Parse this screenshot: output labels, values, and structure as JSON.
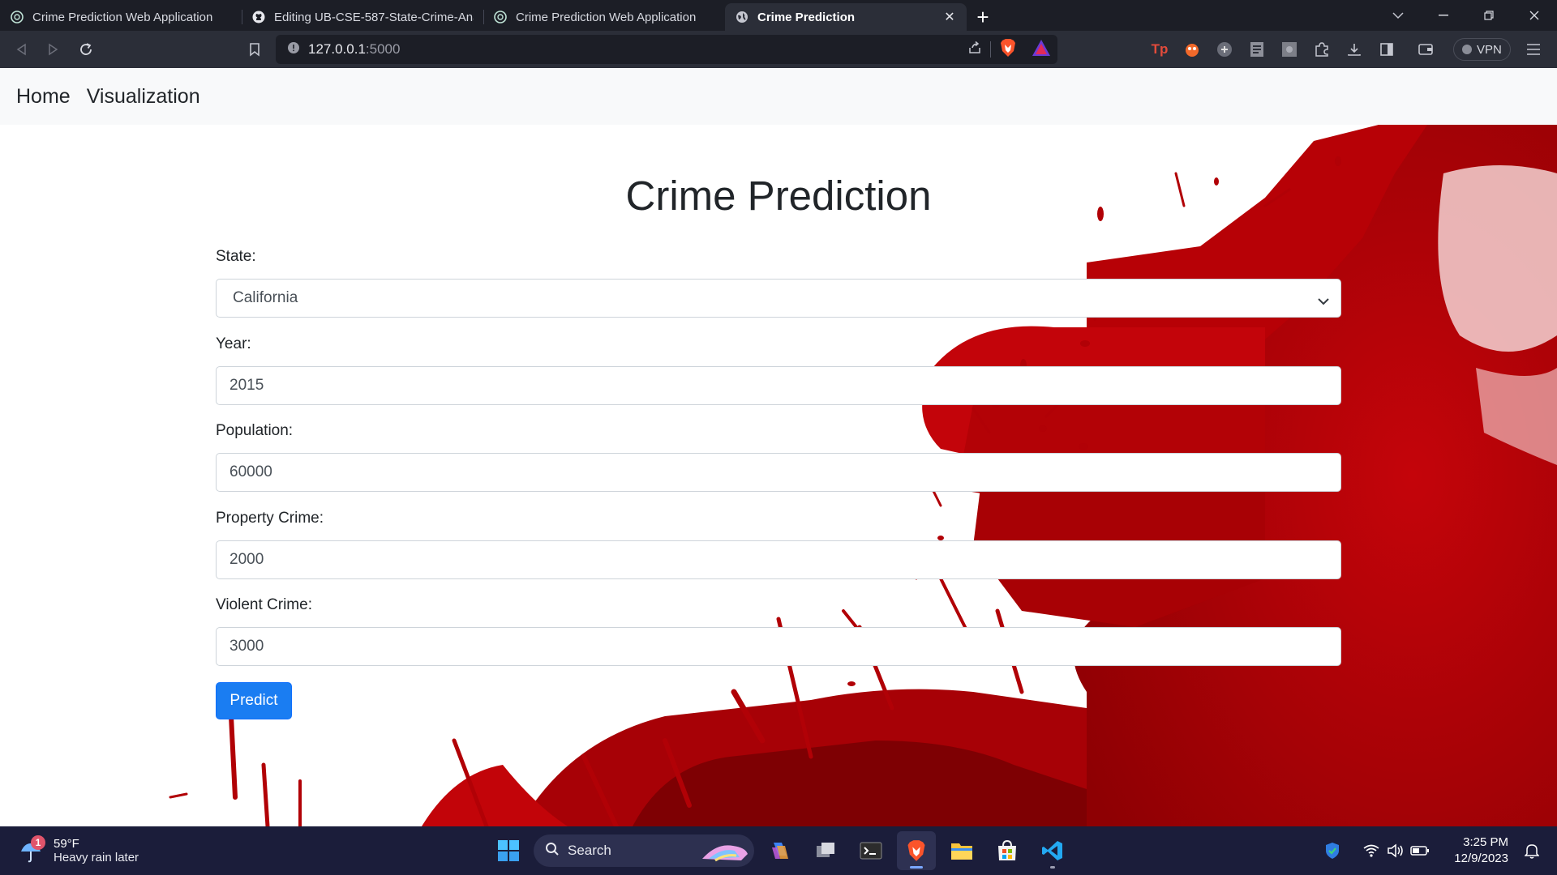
{
  "browser": {
    "tabs": [
      {
        "title": "Crime Prediction Web Application",
        "favicon": "openai-icon",
        "active": false
      },
      {
        "title": "Editing UB-CSE-587-State-Crime-Analy",
        "favicon": "github-icon",
        "active": false
      },
      {
        "title": "Crime Prediction Web Application",
        "favicon": "openai-icon",
        "active": false
      },
      {
        "title": "Crime Prediction",
        "favicon": "globe-icon",
        "active": true
      }
    ],
    "url_host": "127.0.0.1",
    "url_port": ":5000",
    "vpn_label": "VPN"
  },
  "nav": {
    "home": "Home",
    "visualization": "Visualization"
  },
  "form": {
    "title": "Crime Prediction",
    "state_label": "State:",
    "state_value": "California",
    "year_label": "Year:",
    "year_value": "2015",
    "population_label": "Population:",
    "population_value": "60000",
    "property_label": "Property Crime:",
    "property_value": "2000",
    "violent_label": "Violent Crime:",
    "violent_value": "3000",
    "submit_label": "Predict",
    "accent": "#1a7df2"
  },
  "taskbar": {
    "weather_temp": "59°F",
    "weather_desc": "Heavy rain later",
    "weather_badge": "1",
    "search_label": "Search",
    "time": "3:25 PM",
    "date": "12/9/2023"
  }
}
